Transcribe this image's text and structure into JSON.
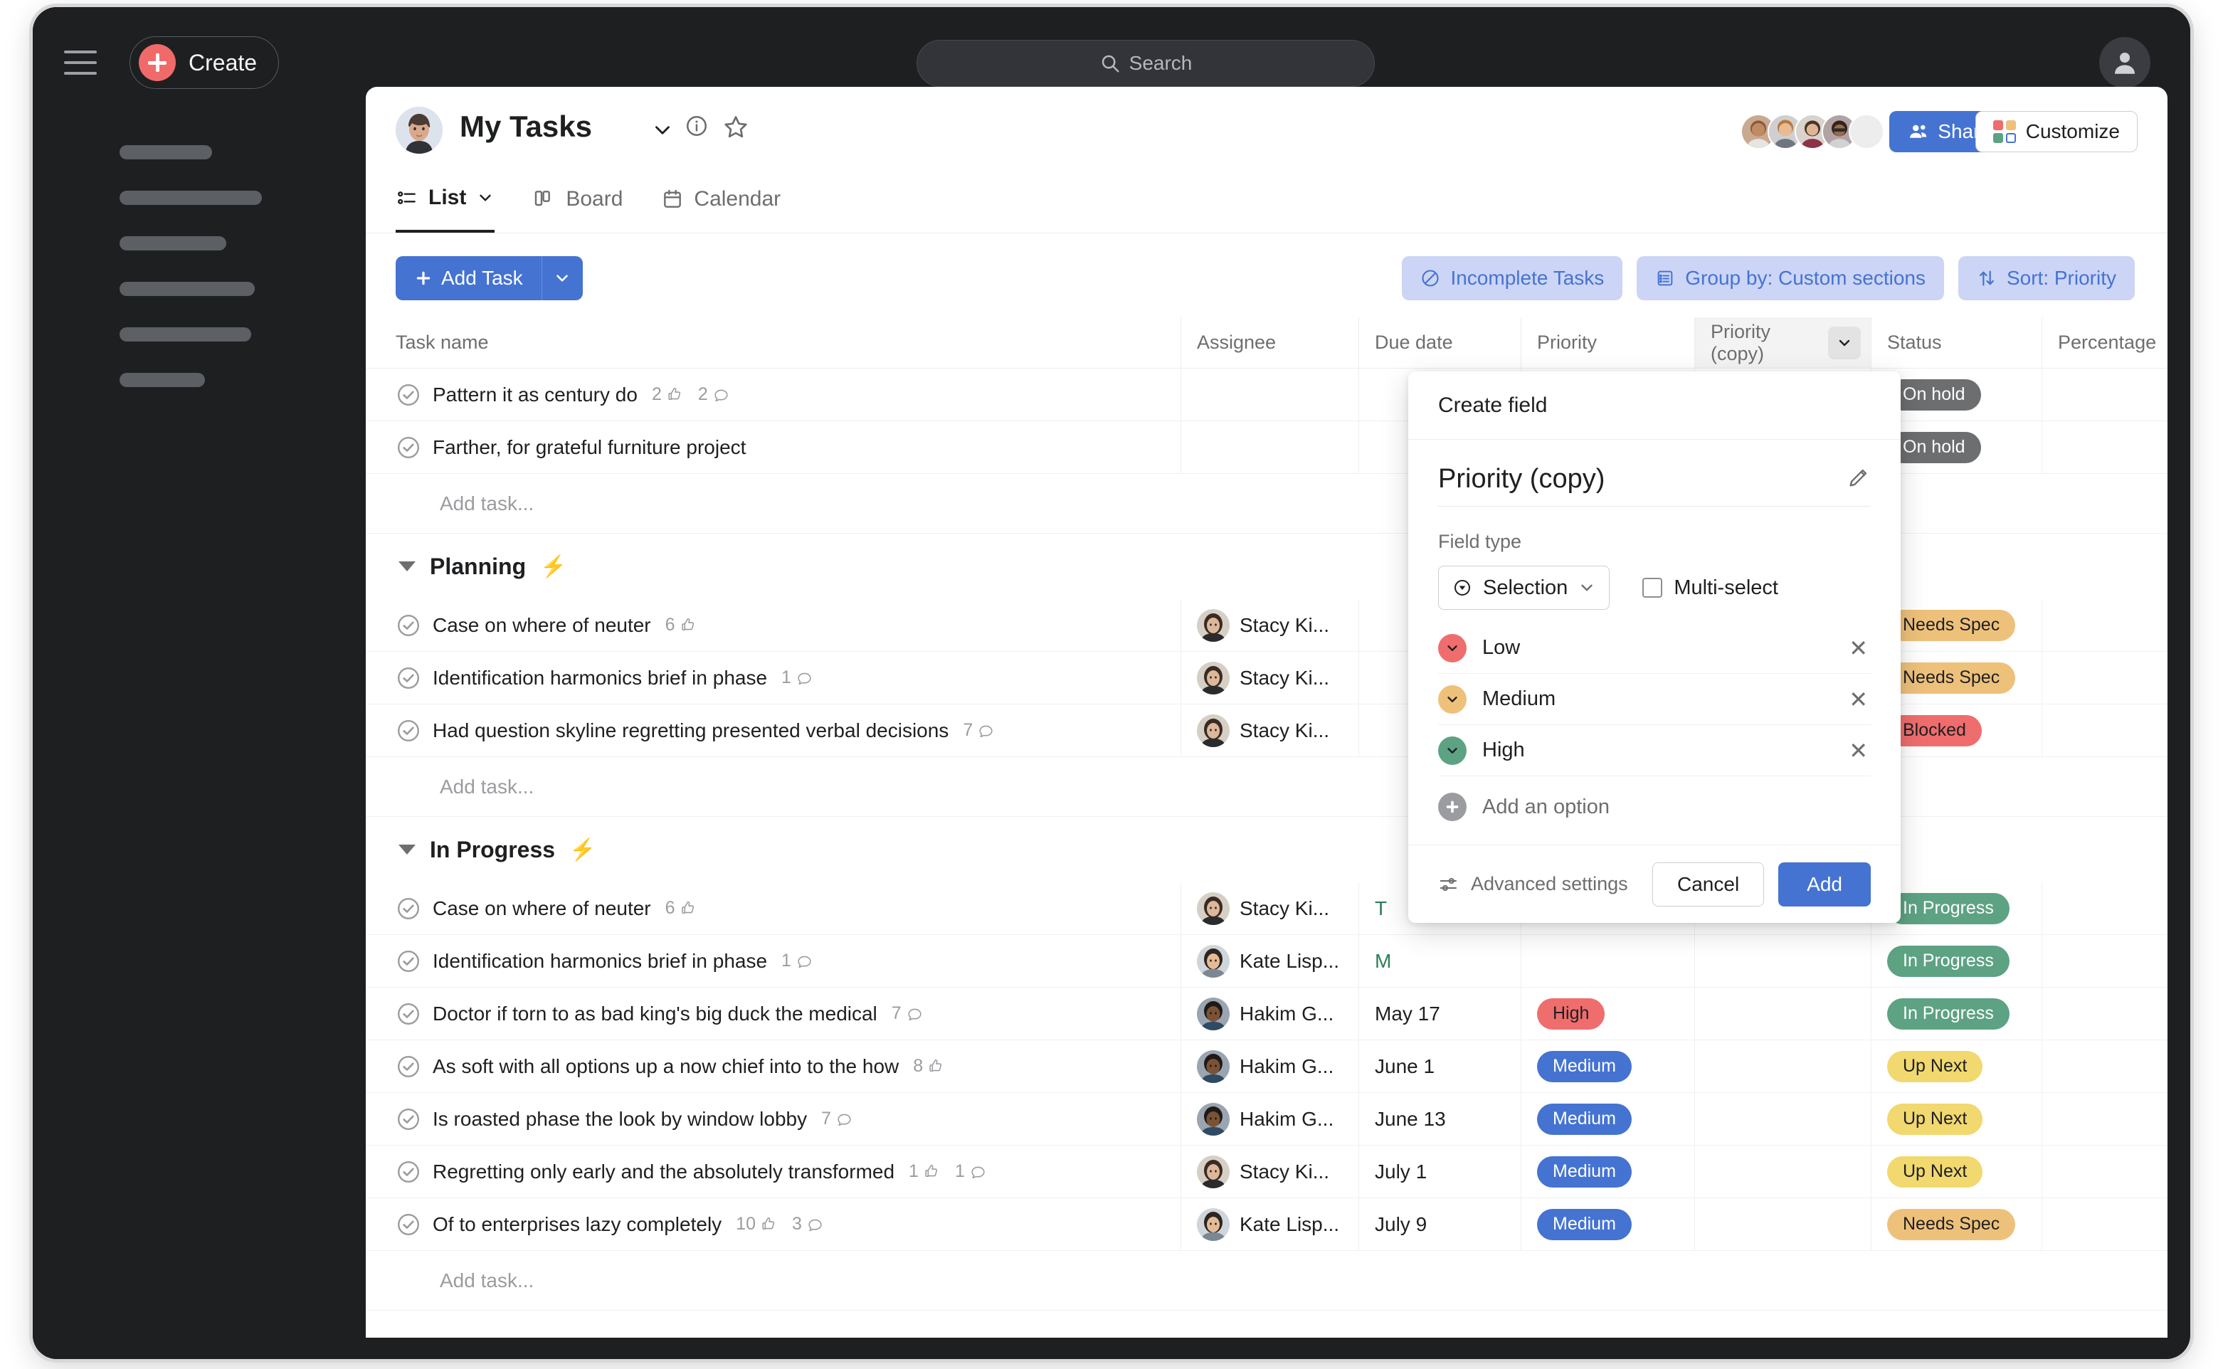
{
  "topbar": {
    "menu_icon": "hamburger-icon",
    "create_label": "Create",
    "search_placeholder": "Search",
    "account_icon": "account-icon"
  },
  "sidebar": {
    "skeleton_widths": [
      130,
      200,
      150,
      190,
      185,
      120
    ]
  },
  "project": {
    "title": "My Tasks",
    "chevron_icon": "chevron-down-icon",
    "info_icon": "info-icon",
    "star_icon": "star-icon",
    "member_count": "5",
    "share_label": "Share",
    "customize_label": "Customize"
  },
  "tabs": [
    {
      "label": "List",
      "icon": "list-icon",
      "active": true,
      "has_caret": true
    },
    {
      "label": "Board",
      "icon": "board-icon",
      "active": false,
      "has_caret": false
    },
    {
      "label": "Calendar",
      "icon": "calendar-icon",
      "active": false,
      "has_caret": false
    }
  ],
  "toolbar": {
    "add_task_label": "Add Task",
    "add_task_caret_icon": "chevron-down-icon",
    "chips": [
      {
        "label": "Incomplete Tasks",
        "icon": "no-entry-icon"
      },
      {
        "label": "Group by: Custom sections",
        "icon": "list-panel-icon"
      },
      {
        "label": "Sort: Priority",
        "icon": "sort-arrows-icon"
      }
    ]
  },
  "table": {
    "columns": [
      "Task name",
      "Assignee",
      "Due date",
      "Priority",
      "Priority (copy)",
      "Status",
      "Percentage"
    ],
    "sorted_column_caret_icon": "chevron-down-icon",
    "add_task_placeholder": "Add task...",
    "groups": [
      {
        "title": null,
        "rows": [
          {
            "name": "Pattern it as century do",
            "likes": "2",
            "comments": "2",
            "assignee": "",
            "due": "",
            "priority": "",
            "priority_copy": "",
            "status": "On hold",
            "status_color": "#6d6e6f",
            "status_text_color": "#ffffff",
            "percentage": ""
          },
          {
            "name": "Farther, for grateful furniture project",
            "likes": "",
            "comments": "",
            "assignee": "",
            "due": "",
            "priority": "",
            "priority_copy": "",
            "status": "On hold",
            "status_color": "#6d6e6f",
            "status_text_color": "#ffffff",
            "percentage": ""
          }
        ]
      },
      {
        "title": "Planning",
        "bolt": "⚡",
        "rows": [
          {
            "name": "Case on where of neuter",
            "likes": "6",
            "comments": "",
            "assignee": "Stacy Ki...",
            "avatar": "stacy",
            "due": "",
            "priority": "",
            "priority_copy": "",
            "status": "Needs Spec",
            "status_color": "#eec17b",
            "status_text_color": "#1e1f21",
            "percentage": ""
          },
          {
            "name": "Identification harmonics brief in phase",
            "likes": "",
            "comments": "1",
            "assignee": "Stacy Ki...",
            "avatar": "stacy",
            "due": "",
            "priority": "",
            "priority_copy": "",
            "status": "Needs Spec",
            "status_color": "#eec17b",
            "status_text_color": "#1e1f21",
            "percentage": ""
          },
          {
            "name": "Had question skyline regretting presented verbal decisions",
            "likes": "",
            "comments": "7",
            "assignee": "Stacy Ki...",
            "avatar": "stacy",
            "due": "",
            "priority": "",
            "priority_copy": "",
            "status": "Blocked",
            "status_color": "#ef6d6d",
            "status_text_color": "#1e1f21",
            "percentage": ""
          }
        ]
      },
      {
        "title": "In Progress",
        "bolt": "⚡",
        "rows": [
          {
            "name": "Case on where of neuter",
            "likes": "6",
            "comments": "",
            "assignee": "Stacy Ki...",
            "avatar": "stacy",
            "due": "T",
            "priority": "",
            "priority_copy": "",
            "status": "In Progress",
            "status_color": "#5da283",
            "status_text_color": "#ffffff",
            "percentage": ""
          },
          {
            "name": "Identification harmonics brief in phase",
            "likes": "",
            "comments": "1",
            "assignee": "Kate Lisp...",
            "avatar": "kate",
            "due": "M",
            "priority": "",
            "priority_copy": "",
            "status": "In Progress",
            "status_color": "#5da283",
            "status_text_color": "#ffffff",
            "percentage": ""
          },
          {
            "name": "Doctor if torn to as bad king's big duck the medical",
            "likes": "",
            "comments": "7",
            "assignee": "Hakim G...",
            "avatar": "hakim",
            "due": "May 17",
            "priority": "High",
            "priority_color": "#ef6d6d",
            "priority_text_color": "#1e1f21",
            "priority_copy": "",
            "status": "In Progress",
            "status_color": "#5da283",
            "status_text_color": "#ffffff",
            "percentage": ""
          },
          {
            "name": "As soft with all options up a now chief into to the how",
            "likes": "8",
            "comments": "",
            "assignee": "Hakim G...",
            "avatar": "hakim",
            "due": "June 1",
            "priority": "Medium",
            "priority_color": "#4573d2",
            "priority_text_color": "#ffffff",
            "priority_copy": "",
            "status": "Up Next",
            "status_color": "#f1d86f",
            "status_text_color": "#1e1f21",
            "percentage": ""
          },
          {
            "name": "Is roasted phase the look by window lobby",
            "likes": "",
            "comments": "7",
            "assignee": "Hakim G...",
            "avatar": "hakim",
            "due": "June 13",
            "priority": "Medium",
            "priority_color": "#4573d2",
            "priority_text_color": "#ffffff",
            "priority_copy": "",
            "status": "Up Next",
            "status_color": "#f1d86f",
            "status_text_color": "#1e1f21",
            "percentage": ""
          },
          {
            "name": "Regretting only early and the absolutely transformed",
            "likes": "1",
            "comments": "1",
            "assignee": "Stacy Ki...",
            "avatar": "stacy",
            "due": "July 1",
            "priority": "Medium",
            "priority_color": "#4573d2",
            "priority_text_color": "#ffffff",
            "priority_copy": "",
            "status": "Up Next",
            "status_color": "#f1d86f",
            "status_text_color": "#1e1f21",
            "percentage": ""
          },
          {
            "name": "Of to enterprises lazy completely",
            "likes": "10",
            "comments": "3",
            "assignee": "Kate Lisp...",
            "avatar": "kate",
            "due": "July 9",
            "priority": "Medium",
            "priority_color": "#4573d2",
            "priority_text_color": "#ffffff",
            "priority_copy": "",
            "status": "Needs Spec",
            "status_color": "#eec17b",
            "status_text_color": "#1e1f21",
            "percentage": ""
          }
        ]
      }
    ]
  },
  "dialog": {
    "header": "Create field",
    "field_name": "Priority (copy)",
    "edit_icon": "pencil-icon",
    "field_type_label": "Field type",
    "field_type_value": "Selection",
    "field_type_icon": "selection-icon",
    "multi_select_label": "Multi-select",
    "multi_select_checked": false,
    "options": [
      {
        "label": "Low",
        "color": "#ef6d6d",
        "remove_icon": "close-icon"
      },
      {
        "label": "Medium",
        "color": "#eec17b",
        "remove_icon": "close-icon"
      },
      {
        "label": "High",
        "color": "#5da283",
        "remove_icon": "close-icon"
      }
    ],
    "add_option_label": "Add an option",
    "advanced_settings_label": "Advanced settings",
    "cancel_label": "Cancel",
    "add_label": "Add"
  },
  "colors": {
    "accent_blue": "#4573d2",
    "create_red": "#f06a6a",
    "chip_bg": "#ccd5f5",
    "bolt_orange": "#f5a623"
  }
}
